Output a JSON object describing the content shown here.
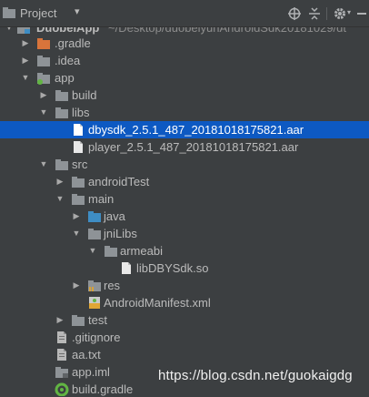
{
  "toolbar": {
    "title": "Project",
    "dropdown_glyph": "▾"
  },
  "tree": {
    "root_label": "DuobeiApp",
    "root_path": "~/Desktop/duobeiyunAndroidSdk20181029/dt",
    "gradle_dir": ".gradle",
    "idea_dir": ".idea",
    "app_module": "app",
    "build_dir": "build",
    "libs_dir": "libs",
    "aar_file_1": "dbysdk_2.5.1_487_20181018175821.aar",
    "aar_file_2": "player_2.5.1_487_20181018175821.aar",
    "src_dir": "src",
    "android_test_dir": "androidTest",
    "main_dir": "main",
    "java_dir": "java",
    "jnilibs_dir": "jniLibs",
    "armeabi_dir": "armeabi",
    "so_file": "libDBYSdk.so",
    "res_dir": "res",
    "manifest_file": "AndroidManifest.xml",
    "test_dir": "test",
    "gitignore_file": ".gitignore",
    "aa_txt_file": "aa.txt",
    "app_iml_file": "app.iml",
    "build_gradle_file": "build.gradle"
  },
  "watermark": "https://blog.csdn.net/guokaigdg",
  "icons": {
    "folder": "folder-icon",
    "module": "module-folder-icon",
    "file": "file-icon",
    "gradle": "gradle-icon",
    "manifest": "manifest-icon"
  },
  "colors": {
    "panel_bg": "#3c3f41",
    "selection": "#0d59c2",
    "folder_grey": "#8e9397",
    "folder_orange": "#d8743b",
    "folder_blue": "#3e8dc4",
    "module_green": "#62b543"
  }
}
